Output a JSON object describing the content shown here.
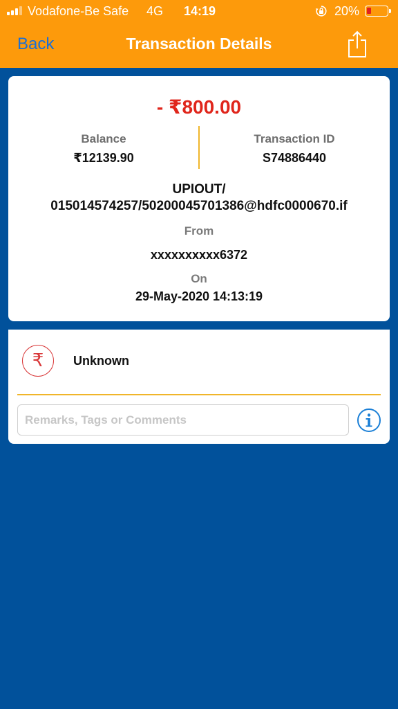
{
  "status_bar": {
    "carrier": "Vodafone-Be Safe",
    "network": "4G",
    "time": "14:19",
    "battery": "20%",
    "battery_level": 0.2,
    "signal_bars": 3
  },
  "header": {
    "back_label": "Back",
    "title": "Transaction Details",
    "share_icon": "share-icon"
  },
  "transaction": {
    "amount": "- ₹800.00",
    "balance_label": "Balance",
    "balance_value": "₹12139.90",
    "txn_id_label": "Transaction ID",
    "txn_id_value": "S74886440",
    "description_line1": "UPIOUT/",
    "description_line2": "015014574257/50200045701386@hdfc0000670.if",
    "from_label": "From",
    "from_value": "xxxxxxxxxx6372",
    "on_label": "On",
    "on_value": "29-May-2020 14:13:19"
  },
  "details": {
    "category_icon": "₹",
    "category": "Unknown",
    "remarks_placeholder": "Remarks, Tags or Comments",
    "remarks_value": "",
    "info_icon": "info-icon"
  },
  "colors": {
    "header_bg": "#fd9a0b",
    "page_bg": "#01519b",
    "amount_debit": "#e0261c",
    "accent_line": "#f0b52a",
    "back_link": "#1a6fd6",
    "info_blue": "#1a7fd6"
  }
}
